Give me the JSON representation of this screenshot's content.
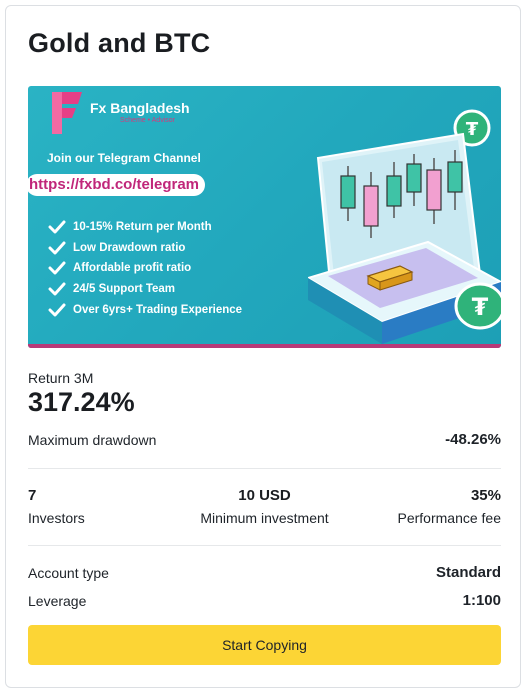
{
  "card": {
    "title": "Gold and BTC"
  },
  "banner": {
    "brand": "Fx Bangladesh",
    "brand_sub": "Scheme • Advisor",
    "join_text": "Join our Telegram Channel",
    "url": "https://fxbd.co/telegram",
    "features": [
      "10-15% Return per Month",
      "Low Drawdown ratio",
      "Affordable profit ratio",
      "24/5 Support Team",
      "Over 6yrs+ Trading Experience"
    ],
    "colors": {
      "background": "#22a8bd",
      "accent": "#c0267a"
    }
  },
  "stats": {
    "return_label": "Return 3M",
    "return_value": "317.24%",
    "drawdown_label": "Maximum drawdown",
    "drawdown_value": "-48.26%",
    "investors_value": "7",
    "investors_label": "Investors",
    "min_invest_value": "10 USD",
    "min_invest_label": "Minimum investment",
    "perf_fee_value": "35%",
    "perf_fee_label": "Performance fee",
    "account_type_label": "Account type",
    "account_type_value": "Standard",
    "leverage_label": "Leverage",
    "leverage_value": "1:100"
  },
  "actions": {
    "start_copying_label": "Start Copying",
    "button_color": "#fcd535"
  }
}
